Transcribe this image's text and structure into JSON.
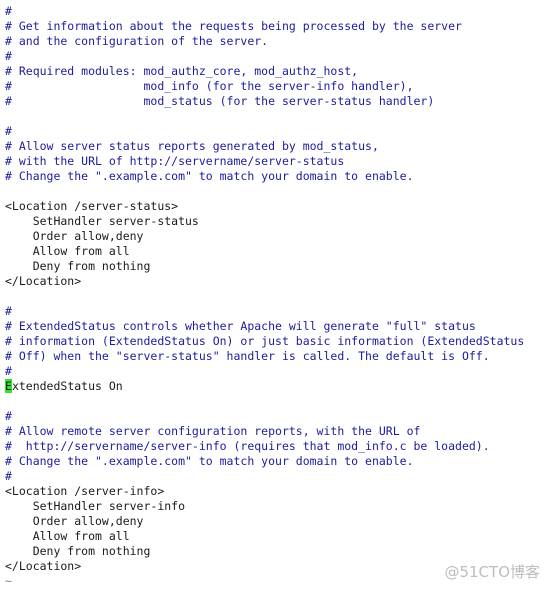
{
  "editor": {
    "lines": [
      {
        "text": "#",
        "kind": "comment"
      },
      {
        "text": "# Get information about the requests being processed by the server",
        "kind": "comment"
      },
      {
        "text": "# and the configuration of the server.",
        "kind": "comment"
      },
      {
        "text": "#",
        "kind": "comment"
      },
      {
        "text": "# Required modules: mod_authz_core, mod_authz_host,",
        "kind": "comment"
      },
      {
        "text": "#                   mod_info (for the server-info handler),",
        "kind": "comment"
      },
      {
        "text": "#                   mod_status (for the server-status handler)",
        "kind": "comment"
      },
      {
        "text": "",
        "kind": "blank"
      },
      {
        "text": "#",
        "kind": "comment"
      },
      {
        "text": "# Allow server status reports generated by mod_status,",
        "kind": "comment"
      },
      {
        "text": "# with the URL of http://servername/server-status",
        "kind": "comment"
      },
      {
        "text": "# Change the \".example.com\" to match your domain to enable.",
        "kind": "comment"
      },
      {
        "text": "",
        "kind": "blank"
      },
      {
        "text": "<Location /server-status>",
        "kind": "code"
      },
      {
        "text": "    SetHandler server-status",
        "kind": "code"
      },
      {
        "text": "    Order allow,deny",
        "kind": "code"
      },
      {
        "text": "    Allow from all",
        "kind": "code"
      },
      {
        "text": "    Deny from nothing",
        "kind": "code"
      },
      {
        "text": "</Location>",
        "kind": "code"
      },
      {
        "text": "",
        "kind": "blank"
      },
      {
        "text": "#",
        "kind": "comment"
      },
      {
        "text": "# ExtendedStatus controls whether Apache will generate \"full\" status",
        "kind": "comment"
      },
      {
        "text": "# information (ExtendedStatus On) or just basic information (ExtendedStatus",
        "kind": "comment"
      },
      {
        "text": "# Off) when the \"server-status\" handler is called. The default is Off.",
        "kind": "comment"
      },
      {
        "text": "#",
        "kind": "comment"
      },
      {
        "text": "ExtendedStatus On",
        "kind": "cursor-line",
        "cursor_char": "E",
        "rest": "xtendedStatus On"
      },
      {
        "text": "",
        "kind": "blank"
      },
      {
        "text": "#",
        "kind": "comment"
      },
      {
        "text": "# Allow remote server configuration reports, with the URL of",
        "kind": "comment"
      },
      {
        "text": "#  http://servername/server-info (requires that mod_info.c be loaded).",
        "kind": "comment"
      },
      {
        "text": "# Change the \".example.com\" to match your domain to enable.",
        "kind": "comment"
      },
      {
        "text": "#",
        "kind": "comment"
      },
      {
        "text": "<Location /server-info>",
        "kind": "code"
      },
      {
        "text": "    SetHandler server-info",
        "kind": "code"
      },
      {
        "text": "    Order allow,deny",
        "kind": "code"
      },
      {
        "text": "    Allow from all",
        "kind": "code"
      },
      {
        "text": "    Deny from nothing",
        "kind": "code"
      },
      {
        "text": "</Location>",
        "kind": "code"
      },
      {
        "text": "~",
        "kind": "tilde"
      }
    ]
  },
  "watermark": {
    "text": "@51CTO博客"
  },
  "colors": {
    "comment": "#1c1c9c",
    "code": "#1a1a1a",
    "cursor": "#2ee82e",
    "background": "#ffffff"
  }
}
